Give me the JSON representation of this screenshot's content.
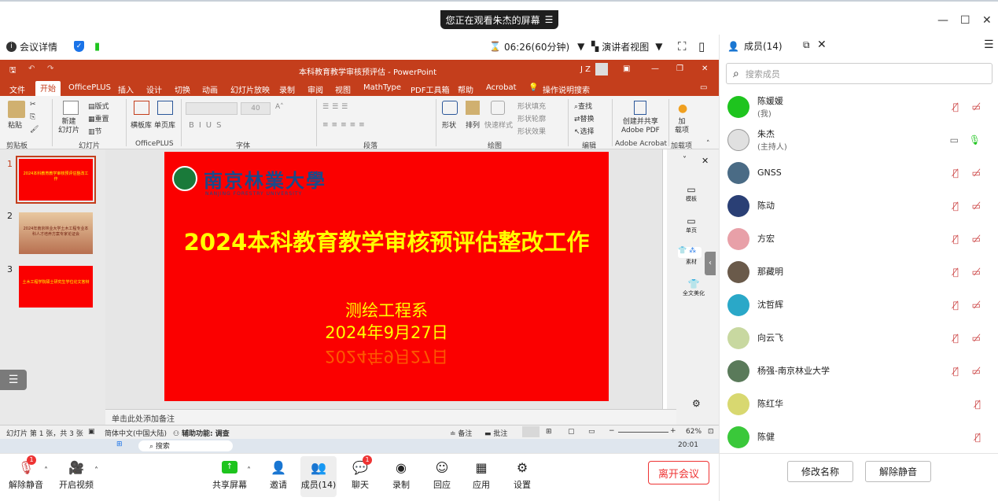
{
  "top": {
    "sharing_banner": "您正在观看朱杰的屏幕",
    "window_min": "—",
    "window_max": "☐",
    "window_close": "✕"
  },
  "meeting_bar": {
    "meeting_info": "会议详情",
    "timer": "06:26(60分钟)",
    "view_mode": "演讲者视图"
  },
  "ppt": {
    "window_title": "本科教育教学审核预评估 - PowerPoint",
    "user_initials": "J Z",
    "tabs": [
      "文件",
      "开始",
      "OfficePLUS",
      "插入",
      "设计",
      "切换",
      "动画",
      "幻灯片放映",
      "录制",
      "审阅",
      "视图",
      "MathType",
      "PDF工具箱",
      "帮助",
      "Acrobat",
      "操作说明搜索"
    ],
    "ribbon": {
      "paste": "粘贴",
      "clipboard": "剪贴板",
      "new_slide": "新建\n幻灯片",
      "layout": "版式",
      "reset": "重置",
      "section": "节",
      "slides_group": "幻灯片",
      "template_lib": "横板库",
      "single_lib": "单页库",
      "officeplus_group": "OfficePLUS",
      "font_size": "40",
      "font_group": "字体",
      "paragraph_group": "段落",
      "shape": "形状",
      "arrange": "排列",
      "quick_style": "快速样式",
      "shape_fill": "形状填充",
      "shape_outline": "形状轮廓",
      "shape_effect": "形状效果",
      "drawing_group": "绘图",
      "find": "查找",
      "replace": "替换",
      "select": "选择",
      "editing_group": "编辑",
      "create_share": "创建并共享\nAdobe PDF",
      "acrobat_group": "Adobe Acrobat",
      "addin": "加\n载项",
      "addin_group": "加载项"
    },
    "thumbs": [
      {
        "num": "1",
        "text": "2024本科教育教学审核预评估整改工作"
      },
      {
        "num": "2",
        "text": "2024年南京林业大学土木工程专业本科人才培养方案专家论证会"
      },
      {
        "num": "3",
        "text": "土木工程学院硕士研究生学位论文答辩"
      }
    ],
    "slide": {
      "logo_text": "南京林業大學",
      "logo_sub": "NANJING FORESTRY UNIVERSITY",
      "title": "2024本科教育教学审核预评估整改工作",
      "dept": "测绘工程系",
      "date": "2024年9月27日",
      "reflect_date": "2024年9月27日"
    },
    "right_pane": [
      {
        "label": "模板"
      },
      {
        "label": "单页"
      },
      {
        "label": "素材"
      },
      {
        "label": "全文美化"
      }
    ],
    "notes_placeholder": "单击此处添加备注",
    "status": {
      "slide_count": "幻灯片 第 1 张，共 3 张",
      "language": "简体中文(中国大陆)",
      "accessibility": "辅助功能: 调查",
      "notes": "备注",
      "comments": "批注",
      "zoom": "62%"
    },
    "taskbar": {
      "search": "搜索",
      "time": "20:01"
    }
  },
  "bottom_bar": {
    "unmute": "解除静音",
    "start_video": "开启视频",
    "share_screen": "共享屏幕",
    "invite": "邀请",
    "members": "成员(14)",
    "chat": "聊天",
    "chat_badge": "1",
    "record": "录制",
    "reply": "回应",
    "apps": "应用",
    "settings": "设置",
    "leave": "离开会议",
    "mute_badge": "1"
  },
  "members_panel": {
    "title": "成员(14)",
    "search_placeholder": "搜索成员",
    "members": [
      {
        "name": "陈媛媛",
        "role": "(我)",
        "color": "#1ec41e"
      },
      {
        "name": "朱杰",
        "role": "(主持人)",
        "color": "#e0e0e0"
      },
      {
        "name": "GNSS",
        "role": "",
        "color": "#4a6b85"
      },
      {
        "name": "陈动",
        "role": "",
        "color": "#2a3f75"
      },
      {
        "name": "方宏",
        "role": "",
        "color": "#e8a0a8"
      },
      {
        "name": "那藏明",
        "role": "",
        "color": "#6a5a4a"
      },
      {
        "name": "沈哲辉",
        "role": "",
        "color": "#2aa8c8"
      },
      {
        "name": "向云飞",
        "role": "",
        "color": "#c8d8a0"
      },
      {
        "name": "杨强-南京林业大学",
        "role": "",
        "color": "#5a7a5a"
      },
      {
        "name": "陈红华",
        "role": "",
        "color": "#d8d870"
      },
      {
        "name": "陈健",
        "role": "",
        "color": "#3ac83a"
      }
    ],
    "rename": "修改名称",
    "unmute_all": "解除静音"
  }
}
